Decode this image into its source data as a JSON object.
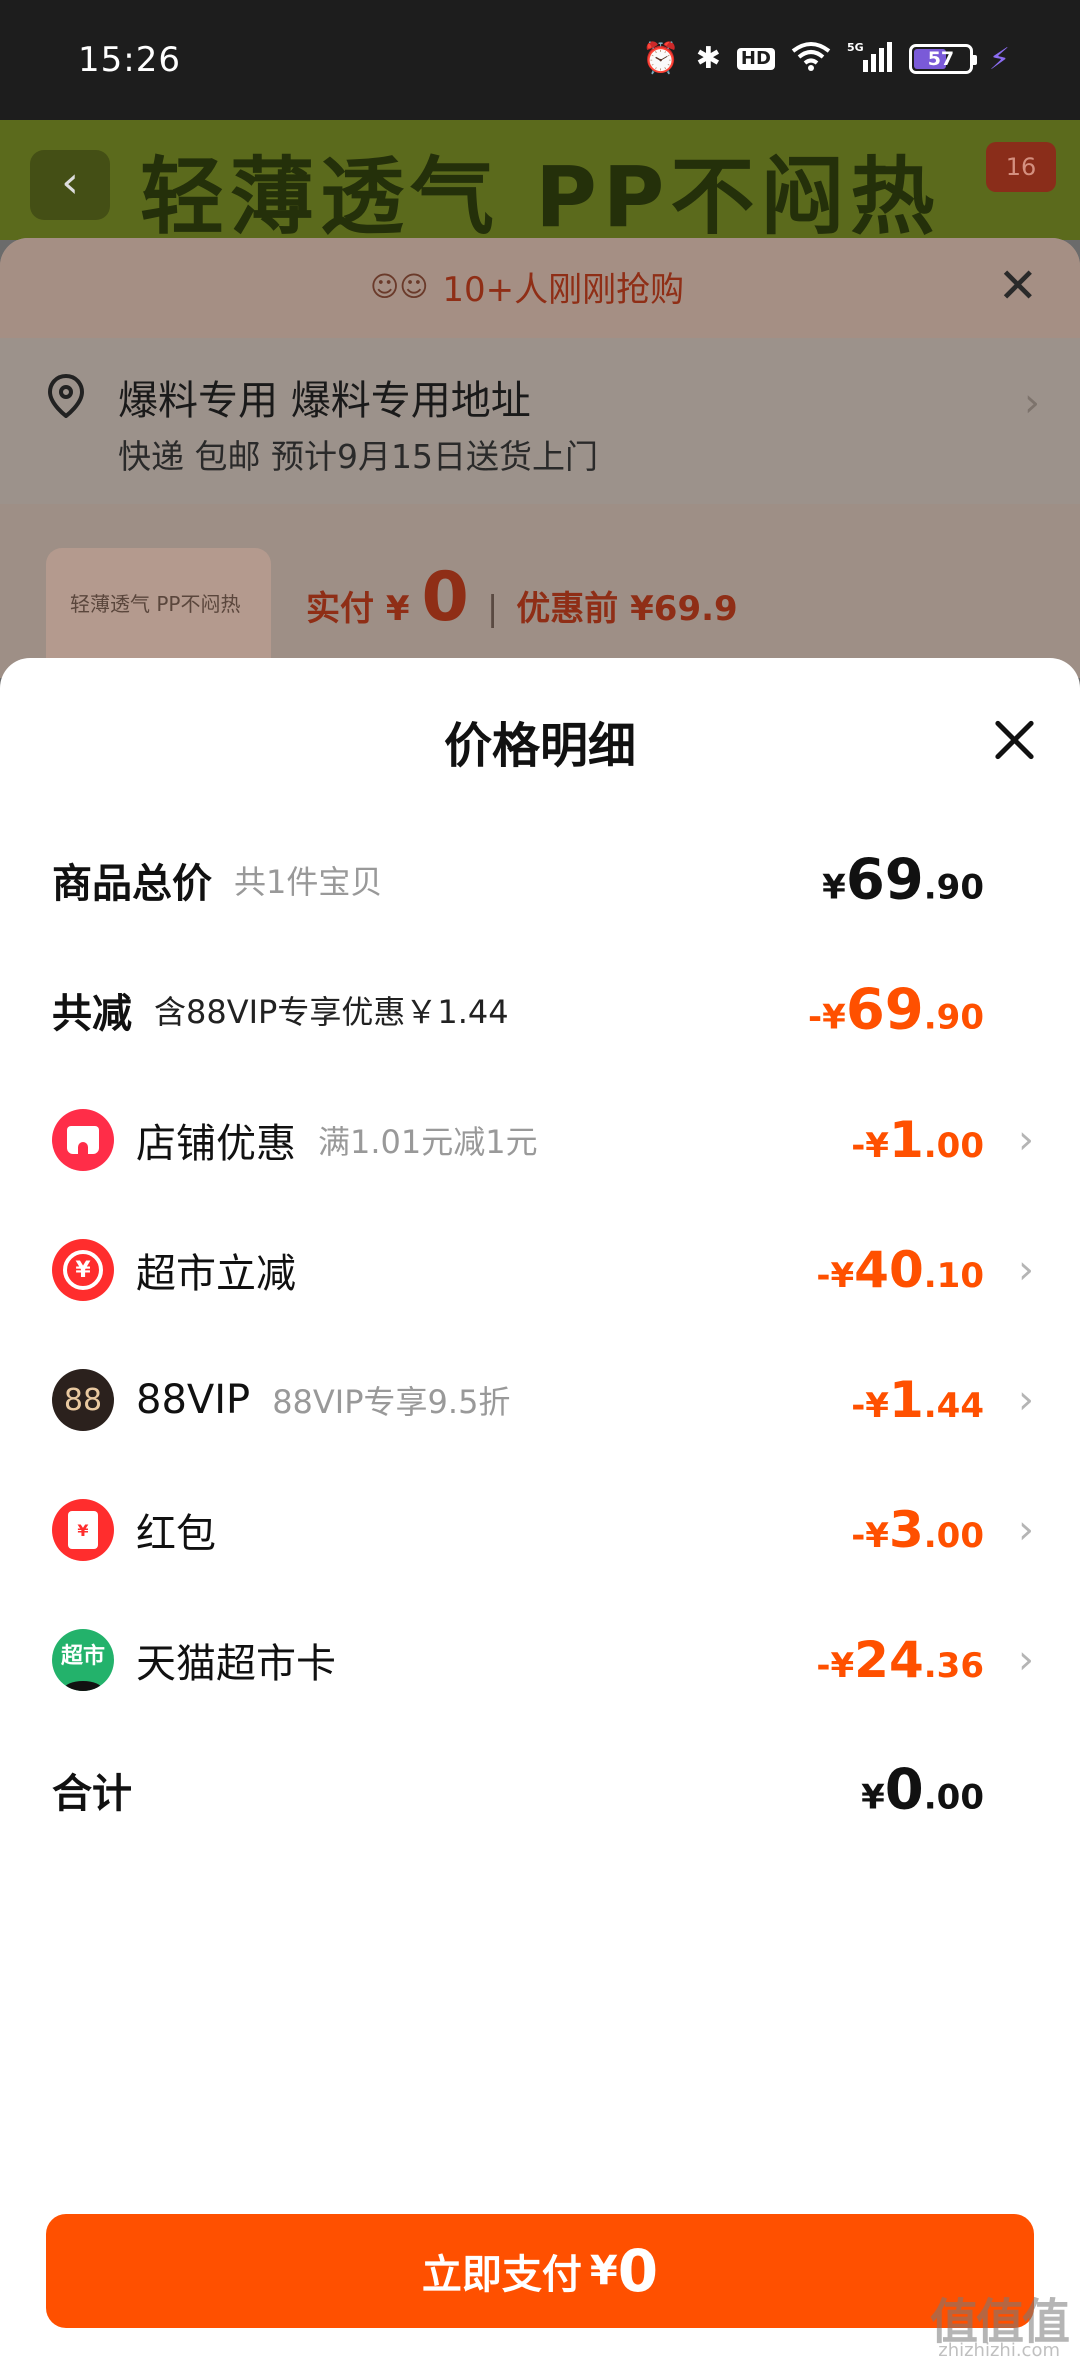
{
  "status_bar": {
    "time": "15:26",
    "battery": "57",
    "icons": [
      "alarm-icon",
      "bluetooth-icon",
      "hd-icon",
      "wifi-icon",
      "signal-5g-icon",
      "battery-icon",
      "charging-icon"
    ],
    "hd_label": "HD"
  },
  "background": {
    "banner_text": "轻薄透气 PP不闷热",
    "banner_badge": "16",
    "order_sheet": {
      "buyers_text": "10+人刚刚抢购",
      "address_name": "爆料专用 爆料专用地址",
      "address_detail": "快递 包邮 预计9月15日送货上门",
      "thumb_text": "轻薄透气 PP不闷热",
      "paid_label": "实付 ¥",
      "paid_amount": "0",
      "before_label": "优惠前 ¥69.9"
    }
  },
  "price_detail": {
    "title": "价格明细",
    "total": {
      "label": "商品总价",
      "sub": "共1件宝贝",
      "currency": "¥",
      "int": "69",
      "dec": ".90"
    },
    "reduction": {
      "label": "共减",
      "sub": "含88VIP专享优惠￥1.44",
      "currency": "-¥",
      "int": "69",
      "dec": ".90"
    },
    "items": [
      {
        "label": "店铺优惠",
        "sub": "满1.01元减1元",
        "currency": "-¥",
        "int": "1",
        "dec": ".00",
        "icon": "shop-icon"
      },
      {
        "label": "超市立减",
        "sub": "",
        "currency": "-¥",
        "int": "40",
        "dec": ".10",
        "icon": "yuan-coin-icon"
      },
      {
        "label": "88VIP",
        "sub": "88VIP专享9.5折",
        "currency": "-¥",
        "int": "1",
        "dec": ".44",
        "icon": "vip88-icon",
        "icon_text": "88"
      },
      {
        "label": "红包",
        "sub": "",
        "currency": "-¥",
        "int": "3",
        "dec": ".00",
        "icon": "red-envelope-icon",
        "icon_text": "¥"
      },
      {
        "label": "天猫超市卡",
        "sub": "",
        "currency": "-¥",
        "int": "24",
        "dec": ".36",
        "icon": "tmall-market-card-icon",
        "icon_text": "超市"
      }
    ],
    "sum": {
      "label": "合计",
      "currency": "¥",
      "int": "0",
      "dec": ".00"
    }
  },
  "pay_button": {
    "label": "立即支付",
    "currency": "¥",
    "amount": "0"
  },
  "watermark": {
    "text": "值值值",
    "sub": "zhizhizhi.com"
  }
}
